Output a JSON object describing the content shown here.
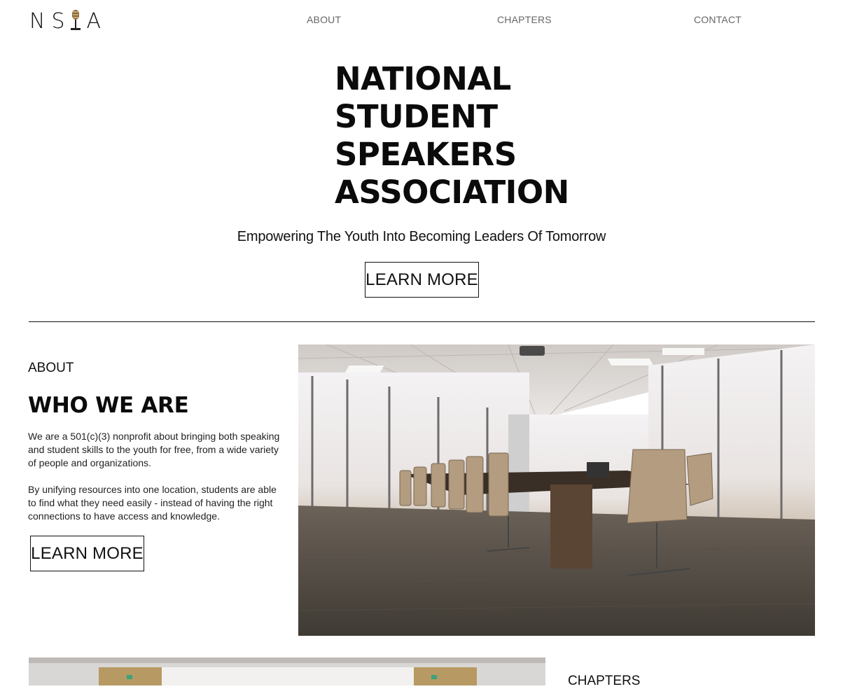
{
  "header": {
    "logo_text_left": "NS",
    "logo_text_right": "A",
    "logo_icon": "microphone-icon",
    "nav": [
      {
        "label": "ABOUT"
      },
      {
        "label": "CHAPTERS"
      },
      {
        "label": "CONTACT"
      }
    ]
  },
  "hero": {
    "title_lines": [
      "NATIONAL",
      "STUDENT",
      "SPEAKERS",
      "ASSOCIATION"
    ],
    "tagline": "Empowering The Youth Into Becoming Leaders Of Tomorrow",
    "cta_label": "LEARN MORE"
  },
  "about": {
    "section_label": "ABOUT",
    "heading": "WHO WE ARE",
    "paragraph1": "We are a 501(c)(3) nonprofit about bringing both speaking and student skills to the youth for free, from a wide variety of people and organizations.",
    "paragraph2": "By unifying resources into one location, students are able to find what they need easily - instead of having the right connections to have access and knowledge.",
    "cta_label": "LEARN MORE"
  },
  "chapters": {
    "section_label": "CHAPTERS"
  },
  "colors": {
    "text": "#111111",
    "nav": "#666666",
    "background": "#ffffff"
  }
}
